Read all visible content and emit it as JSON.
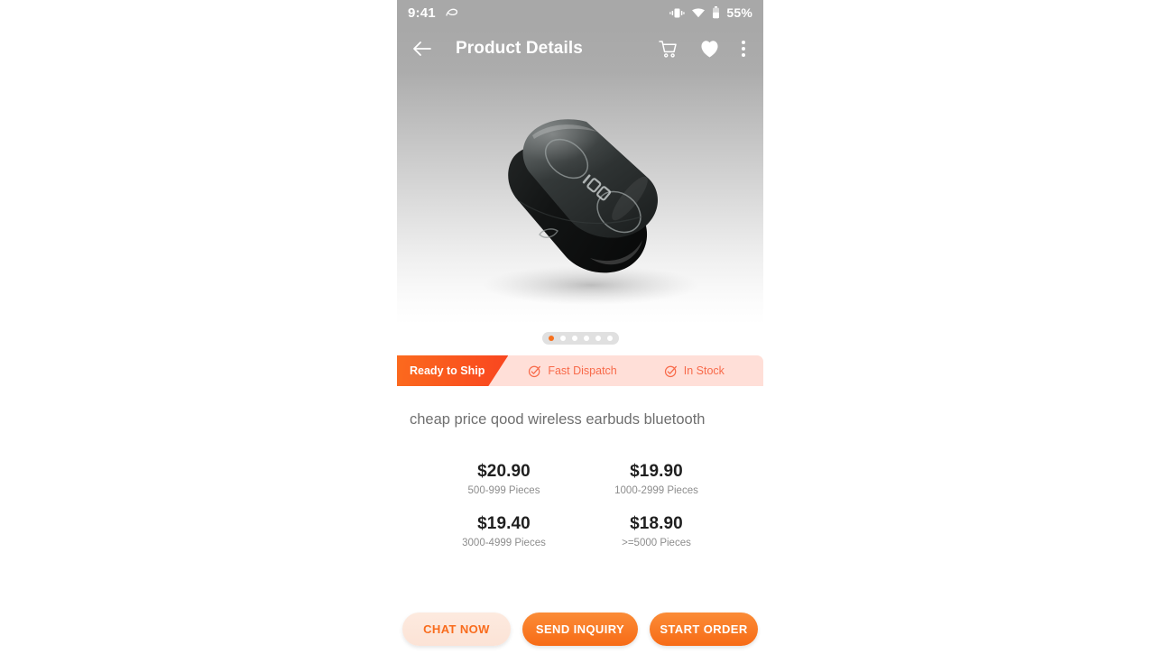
{
  "status_bar": {
    "time": "9:41",
    "notification_icon": "swoosh-notification-icon",
    "vibrate_icon": "vibrate-icon",
    "wifi_icon": "wifi-icon",
    "battery_icon": "battery-icon",
    "battery_text": "55%"
  },
  "app_bar": {
    "back_icon": "back-arrow-icon",
    "title": "Product Details",
    "cart_icon": "shopping-cart-icon",
    "favorite_icon": "heart-filled-icon",
    "overflow_icon": "more-vertical-icon"
  },
  "gallery": {
    "image_alt": "black wireless earbuds charging case",
    "dot_count": 6,
    "active_dot": 0
  },
  "ready_banner": {
    "tag_label": "Ready to Ship",
    "features": [
      {
        "label": "Fast Dispatch",
        "icon": "check-circle-icon"
      },
      {
        "label": "In Stock",
        "icon": "check-circle-icon"
      }
    ]
  },
  "product": {
    "title": "cheap price qood wireless earbuds bluetooth"
  },
  "pricing": {
    "tiers": [
      {
        "amount": "$20.90",
        "quantity": "500-999 Pieces"
      },
      {
        "amount": "$19.90",
        "quantity": "1000-2999 Pieces"
      },
      {
        "amount": "$19.40",
        "quantity": "3000-4999 Pieces"
      },
      {
        "amount": "$18.90",
        "quantity": ">=5000 Pieces"
      }
    ]
  },
  "actions": {
    "chat_label": "CHAT NOW",
    "inquiry_label": "SEND INQUIRY",
    "order_label": "START ORDER"
  },
  "colors": {
    "accent_orange": "#f76b16",
    "accent_orange_deep": "#f9451f",
    "banner_bg": "#ffdfd8",
    "banner_text": "#f86a4a",
    "chat_bg": "#fdeadf",
    "statusbar_gray": "#a8a8a8",
    "title_gray": "#6f6f6f",
    "qty_gray": "#8d8d8d"
  }
}
